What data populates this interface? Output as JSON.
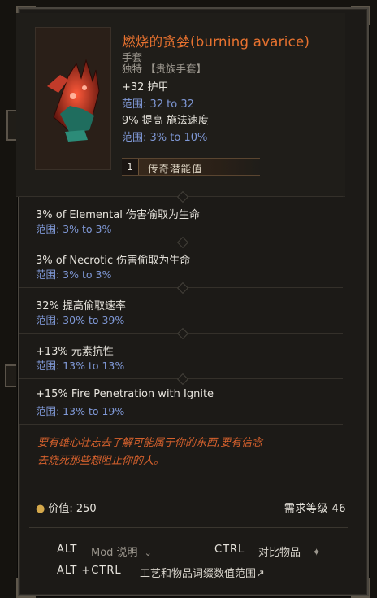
{
  "item": {
    "name": "燃烧的贪婪(burning avarice)",
    "type": "手套",
    "rarity": "独特 【贵族手套】"
  },
  "base_stats": [
    {
      "text": "+32 护甲",
      "range": "范围: 32 to 32"
    },
    {
      "text": "9% 提高 施法速度",
      "range": "范围: 3% to 10%"
    }
  ],
  "legendary_potential": {
    "count": "1",
    "label": "传奇潜能值"
  },
  "affixes": [
    {
      "text": "3% of Elemental 伤害偷取为生命",
      "range": "范围: 3% to 3%"
    },
    {
      "text": "3% of Necrotic 伤害偷取为生命",
      "range": "范围: 3% to 3%"
    },
    {
      "text": "32% 提高偷取速率",
      "range": "范围: 30% to 39%"
    },
    {
      "text": "+13% 元素抗性",
      "range": "范围: 13% to 13%"
    },
    {
      "text": "+15% Fire Penetration with Ignite",
      "range": "范围: 13% to 19%"
    }
  ],
  "lore": [
    "要有雄心壮志去了解可能属于你的东西,要有信念",
    "去烧死那些想阻止你的人。"
  ],
  "footer": {
    "value_label": "价值: 250",
    "requirement": "需求等级 46"
  },
  "controls": {
    "alt_key": "ALT",
    "alt_desc": "Mod 说明",
    "ctrl_key": "CTRL",
    "ctrl_desc": "对比物品",
    "altctrl_key": "ALT +CTRL",
    "altctrl_desc": "工艺和物品词缀数值范围"
  },
  "colors": {
    "title": "#e8722f",
    "range": "#7f98d6",
    "lore": "#d6612d"
  }
}
